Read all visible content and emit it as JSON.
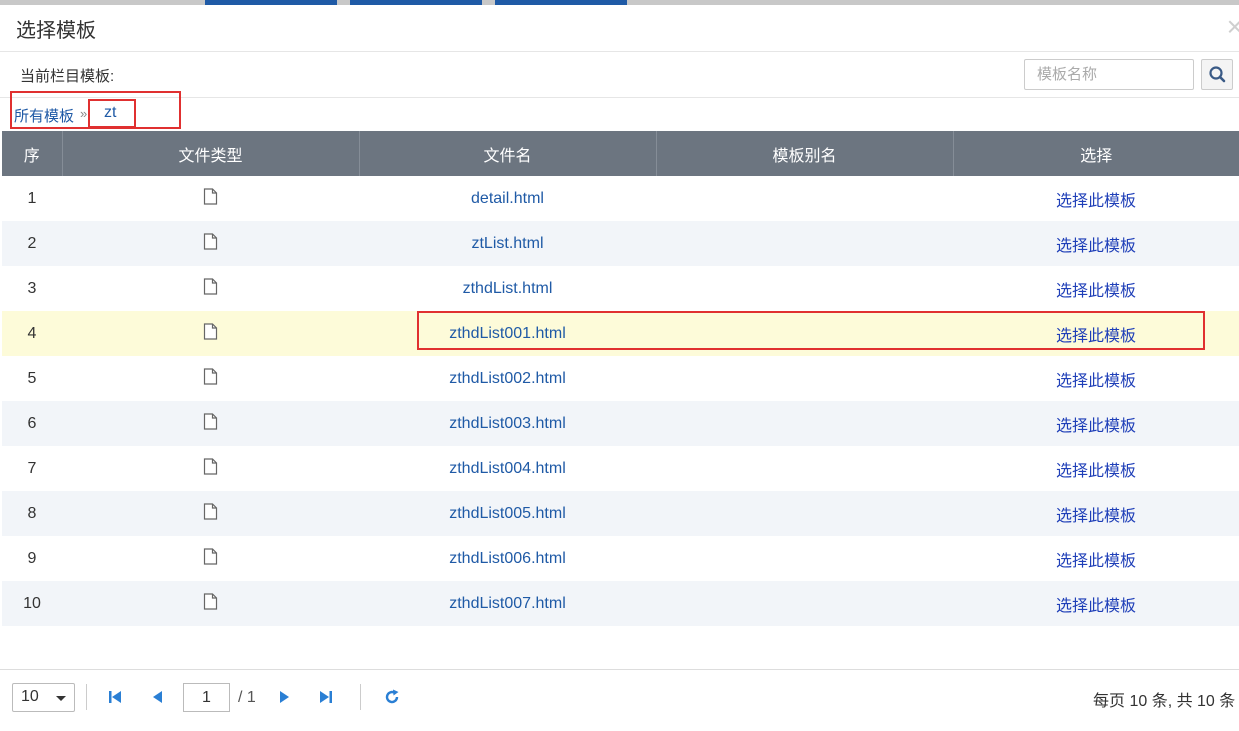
{
  "dialog": {
    "title": "选择模板",
    "close_glyph": "×"
  },
  "toolbar": {
    "current_label": "当前栏目模板:",
    "search_placeholder": "模板名称",
    "search_icon": "search-icon"
  },
  "breadcrumb": {
    "root": "所有模板",
    "separator": "»",
    "current": "zt"
  },
  "table": {
    "columns": [
      "序",
      "文件类型",
      "文件名",
      "模板别名",
      "选择"
    ],
    "rows": [
      {
        "index": "1",
        "filename": "detail.html",
        "alias": "",
        "action": "选择此模板"
      },
      {
        "index": "2",
        "filename": "ztList.html",
        "alias": "",
        "action": "选择此模板"
      },
      {
        "index": "3",
        "filename": "zthdList.html",
        "alias": "",
        "action": "选择此模板"
      },
      {
        "index": "4",
        "filename": "zthdList001.html",
        "alias": "",
        "action": "选择此模板"
      },
      {
        "index": "5",
        "filename": "zthdList002.html",
        "alias": "",
        "action": "选择此模板"
      },
      {
        "index": "6",
        "filename": "zthdList003.html",
        "alias": "",
        "action": "选择此模板"
      },
      {
        "index": "7",
        "filename": "zthdList004.html",
        "alias": "",
        "action": "选择此模板"
      },
      {
        "index": "8",
        "filename": "zthdList005.html",
        "alias": "",
        "action": "选择此模板"
      },
      {
        "index": "9",
        "filename": "zthdList006.html",
        "alias": "",
        "action": "选择此模板"
      },
      {
        "index": "10",
        "filename": "zthdList007.html",
        "alias": "",
        "action": "选择此模板"
      }
    ],
    "highlighted_row": "4",
    "file_type_icon": "document-icon"
  },
  "pager": {
    "page_size": "10",
    "current_page": "1",
    "total_pages": "/ 1",
    "summary": "每页 10 条, 共 10 条"
  },
  "colors": {
    "accent": "#1f5aa6",
    "header_bg": "#6c7580",
    "highlight_row": "#fdfbd9",
    "annotation": "#e03030"
  }
}
